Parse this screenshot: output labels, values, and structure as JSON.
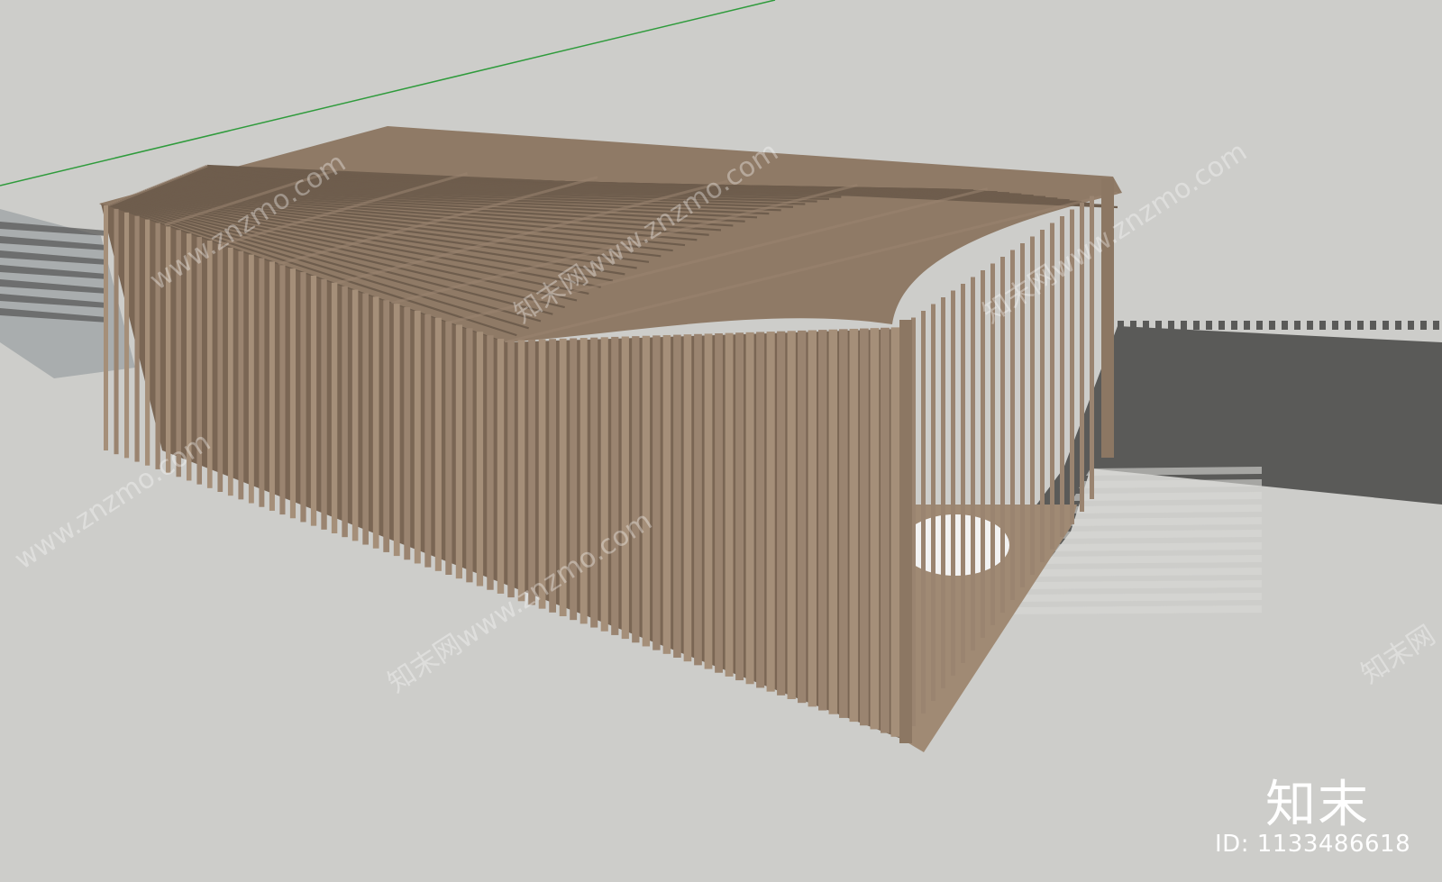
{
  "scene": {
    "subject": "slatted wooden pavilion model",
    "background_color": "#cdcdca",
    "wood_color": "#9a8470",
    "wood_dark": "#6e5d4d",
    "shadow_color": "#5a5a58",
    "pavement_color": "#a9adae",
    "axis_line_color": "#2f9b3c"
  },
  "watermarks": [
    {
      "text": "www.znzmo.com"
    },
    {
      "text": "知末网www.znzmo.com"
    },
    {
      "text": "知末网www.znzmo.com"
    },
    {
      "text": "知末网www.znzmo.com"
    },
    {
      "text": "www.znzmo.com"
    },
    {
      "text": "知末网"
    }
  ],
  "branding": {
    "logo_text": "知末",
    "id_text": "ID: 1133486618"
  }
}
